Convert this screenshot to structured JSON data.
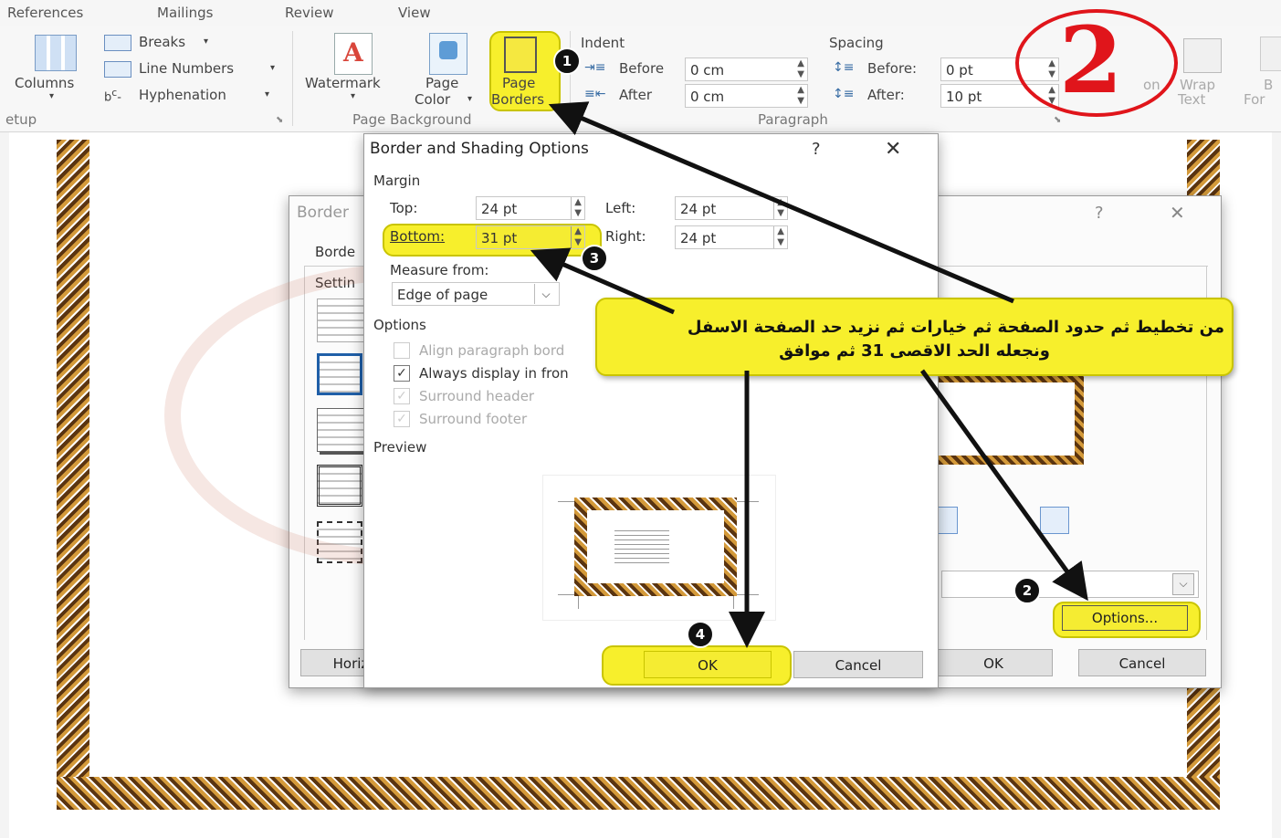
{
  "tabs": [
    "References",
    "Mailings",
    "Review",
    "View"
  ],
  "ribbon": {
    "page_setup": {
      "columns": "Columns",
      "breaks": "Breaks",
      "line_numbers": "Line Numbers",
      "hyphenation": "Hyphenation",
      "group": "etup"
    },
    "page_background": {
      "watermark": "Watermark",
      "page_color": "Page",
      "page_color2": "Color",
      "page_borders": "Page",
      "page_borders2": "Borders",
      "group": "Page Background"
    },
    "paragraph": {
      "indent": "Indent",
      "before": "Before",
      "before_value": "0 cm",
      "after": "After",
      "after_value": "0 cm",
      "spacing": "Spacing",
      "sp_before": "Before:",
      "sp_before_value": "0 pt",
      "sp_after": "After:",
      "sp_after_value": "10 pt",
      "group": "Paragraph"
    },
    "arrange": {
      "position_frag": "on",
      "wrap": "Wrap",
      "wrap2": "Text",
      "bring_frag": "B",
      "bring2_frag": "For"
    }
  },
  "step_number_large": "2",
  "back_dialog": {
    "title_frag": "Border",
    "help": "?",
    "close": "✕",
    "tab_frag": "Borde",
    "setting_frag": "Settin",
    "horizontal_frag": "Horiz",
    "options_button": "Options...",
    "ok": "OK",
    "cancel": "Cancel"
  },
  "dialog": {
    "title": "Border and Shading Options",
    "help": "?",
    "close": "✕",
    "margin": "Margin",
    "top_label": "Top:",
    "top_value": "24 pt",
    "left_label": "Left:",
    "left_value": "24 pt",
    "bottom_label": "Bottom:",
    "bottom_value": "31 pt",
    "right_label": "Right:",
    "right_value": "24 pt",
    "measure_label": "Measure from:",
    "measure_value": "Edge of page",
    "options_label": "Options",
    "opt1": "Align paragraph bord",
    "opt2": "Always display in fron",
    "opt3": "Surround header",
    "opt4": "Surround footer",
    "preview_label": "Preview",
    "ok": "OK",
    "cancel": "Cancel"
  },
  "badges": [
    "1",
    "2",
    "3",
    "4"
  ],
  "callout": {
    "line1": "من تخطيط ثم حدود الصفحة ثم خيارات ثم نزيد حد الصفحة الاسفل",
    "line2": "ونجعله الحد الاقصى 31 ثم موافق"
  },
  "colors": {
    "highlight": "#f7ef2c",
    "circle_red": "#e0151b"
  }
}
